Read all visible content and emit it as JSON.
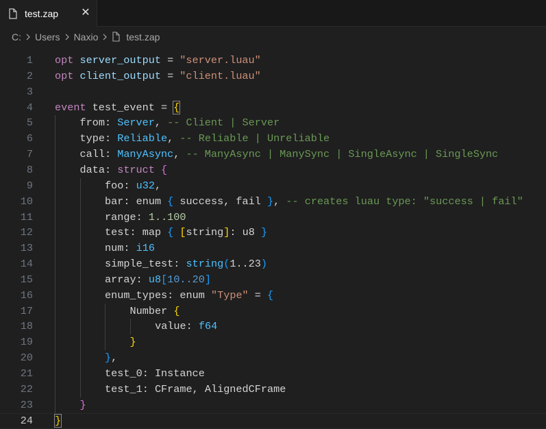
{
  "tab": {
    "label": "test.zap",
    "close_glyph": "✕"
  },
  "breadcrumb": [
    "C:",
    "Users",
    "Naxio",
    "test.zap"
  ],
  "colors": {
    "keyword": "#c586c0",
    "string": "#ce9178",
    "type": "#4fc1ff",
    "comment": "#6a9955",
    "number": "#b5cea8",
    "variable": "#9cdcfe",
    "bracket1": "#ffd700",
    "bracket2": "#da70d6",
    "bracket3": "#179fff"
  },
  "lines": [
    {
      "n": "1",
      "indent": 0,
      "tokens": [
        [
          "kw",
          "opt"
        ],
        [
          "id",
          " "
        ],
        [
          "var",
          "server_output"
        ],
        [
          "id",
          " = "
        ],
        [
          "str",
          "\"server.luau\""
        ]
      ]
    },
    {
      "n": "2",
      "indent": 0,
      "tokens": [
        [
          "kw",
          "opt"
        ],
        [
          "id",
          " "
        ],
        [
          "var",
          "client_output"
        ],
        [
          "id",
          " = "
        ],
        [
          "str",
          "\"client.luau\""
        ]
      ]
    },
    {
      "n": "3",
      "indent": 0,
      "tokens": []
    },
    {
      "n": "4",
      "indent": 0,
      "tokens": [
        [
          "kw",
          "event"
        ],
        [
          "id",
          " test_event = "
        ],
        [
          "b1m",
          "{"
        ]
      ]
    },
    {
      "n": "5",
      "indent": 1,
      "tokens": [
        [
          "id",
          "from: "
        ],
        [
          "typ",
          "Server"
        ],
        [
          "id",
          ", "
        ],
        [
          "cmt",
          "-- Client | Server"
        ]
      ]
    },
    {
      "n": "6",
      "indent": 1,
      "tokens": [
        [
          "id",
          "type: "
        ],
        [
          "typ",
          "Reliable"
        ],
        [
          "id",
          ", "
        ],
        [
          "cmt",
          "-- Reliable | Unreliable"
        ]
      ]
    },
    {
      "n": "7",
      "indent": 1,
      "tokens": [
        [
          "id",
          "call: "
        ],
        [
          "typ",
          "ManyAsync"
        ],
        [
          "id",
          ", "
        ],
        [
          "cmt",
          "-- ManyAsync | ManySync | SingleAsync | SingleSync"
        ]
      ]
    },
    {
      "n": "8",
      "indent": 1,
      "tokens": [
        [
          "id",
          "data: "
        ],
        [
          "kw",
          "struct"
        ],
        [
          "id",
          " "
        ],
        [
          "b2",
          "{"
        ]
      ]
    },
    {
      "n": "9",
      "indent": 2,
      "tokens": [
        [
          "id",
          "foo: "
        ],
        [
          "typ",
          "u32"
        ],
        [
          "id",
          ","
        ]
      ]
    },
    {
      "n": "10",
      "indent": 2,
      "tokens": [
        [
          "id",
          "bar: enum "
        ],
        [
          "b3",
          "{"
        ],
        [
          "id",
          " success, fail "
        ],
        [
          "b3",
          "}"
        ],
        [
          "id",
          ", "
        ],
        [
          "cmt",
          "-- creates luau type: \"success | fail\""
        ]
      ]
    },
    {
      "n": "11",
      "indent": 2,
      "tokens": [
        [
          "id",
          "range: "
        ],
        [
          "num",
          "1..100"
        ]
      ]
    },
    {
      "n": "12",
      "indent": 2,
      "tokens": [
        [
          "id",
          "test: map "
        ],
        [
          "b3",
          "{"
        ],
        [
          "id",
          " "
        ],
        [
          "b1",
          "["
        ],
        [
          "id",
          "string"
        ],
        [
          "b1",
          "]"
        ],
        [
          "id",
          ": u8 "
        ],
        [
          "b3",
          "}"
        ]
      ]
    },
    {
      "n": "13",
      "indent": 2,
      "tokens": [
        [
          "id",
          "num: "
        ],
        [
          "typ",
          "i16"
        ]
      ]
    },
    {
      "n": "14",
      "indent": 2,
      "tokens": [
        [
          "id",
          "simple_test: "
        ],
        [
          "typ",
          "string"
        ],
        [
          "b3",
          "("
        ],
        [
          "id",
          "1..23"
        ],
        [
          "b3",
          ")"
        ]
      ]
    },
    {
      "n": "15",
      "indent": 2,
      "tokens": [
        [
          "id",
          "array: "
        ],
        [
          "typ",
          "u8"
        ],
        [
          "b3",
          "["
        ],
        [
          "blu",
          "10..20"
        ],
        [
          "b3",
          "]"
        ]
      ]
    },
    {
      "n": "16",
      "indent": 2,
      "tokens": [
        [
          "id",
          "enum_types: enum "
        ],
        [
          "str",
          "\"Type\""
        ],
        [
          "id",
          " = "
        ],
        [
          "b3",
          "{"
        ]
      ]
    },
    {
      "n": "17",
      "indent": 3,
      "tokens": [
        [
          "id",
          "Number "
        ],
        [
          "b1",
          "{"
        ]
      ]
    },
    {
      "n": "18",
      "indent": 4,
      "tokens": [
        [
          "id",
          "value: "
        ],
        [
          "typ",
          "f64"
        ]
      ]
    },
    {
      "n": "19",
      "indent": 3,
      "tokens": [
        [
          "b1",
          "}"
        ]
      ]
    },
    {
      "n": "20",
      "indent": 2,
      "tokens": [
        [
          "b3",
          "}"
        ],
        [
          "id",
          ","
        ]
      ]
    },
    {
      "n": "21",
      "indent": 2,
      "tokens": [
        [
          "id",
          "test_0: Instance"
        ]
      ]
    },
    {
      "n": "22",
      "indent": 2,
      "tokens": [
        [
          "id",
          "test_1: CFrame, AlignedCFrame"
        ]
      ]
    },
    {
      "n": "23",
      "indent": 1,
      "tokens": [
        [
          "b2",
          "}"
        ]
      ]
    },
    {
      "n": "24",
      "indent": 0,
      "tokens": [
        [
          "b1m",
          "}"
        ]
      ]
    }
  ]
}
